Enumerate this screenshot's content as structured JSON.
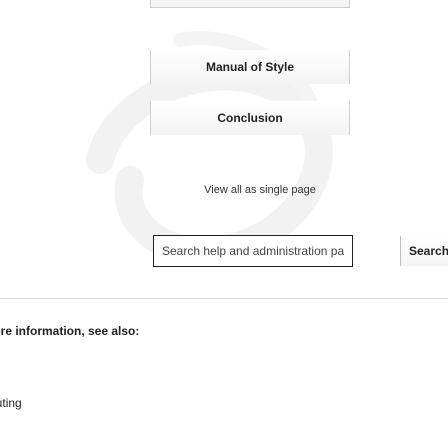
{
  "nav_buttons": {
    "manual_of_style": "Manual of Style",
    "conclusion": "Conclusion"
  },
  "single_page_link": "View all as single page",
  "search": {
    "placeholder": "Search help and administration pages",
    "button_label": "Search"
  },
  "see_also_heading": "For more information, see also:",
  "contributing_item": "Contributing"
}
